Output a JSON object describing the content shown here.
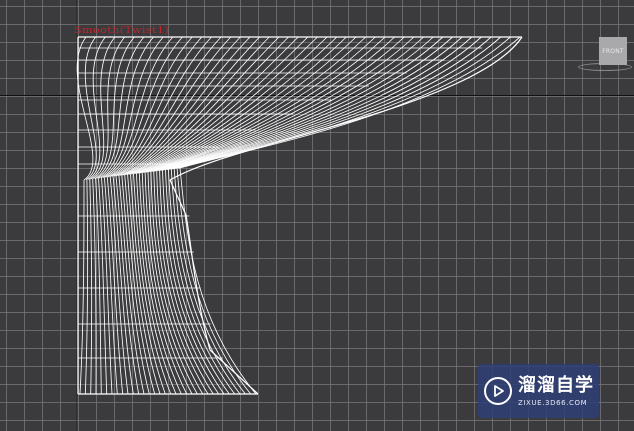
{
  "viewport": {
    "selection_label": "Smooth(Twist1)",
    "viewcube_label": "FRONT",
    "background_color": "#3b3b3d",
    "grid_color": "#78787c",
    "wireframe_color": "#ffffff",
    "selection_label_color": "#c2242a"
  },
  "watermark": {
    "logo_icon": "play-icon",
    "title": "溜溜自学",
    "subtitle": "ZIXUE.3D66.COM",
    "background_color": "#2f3f76"
  }
}
